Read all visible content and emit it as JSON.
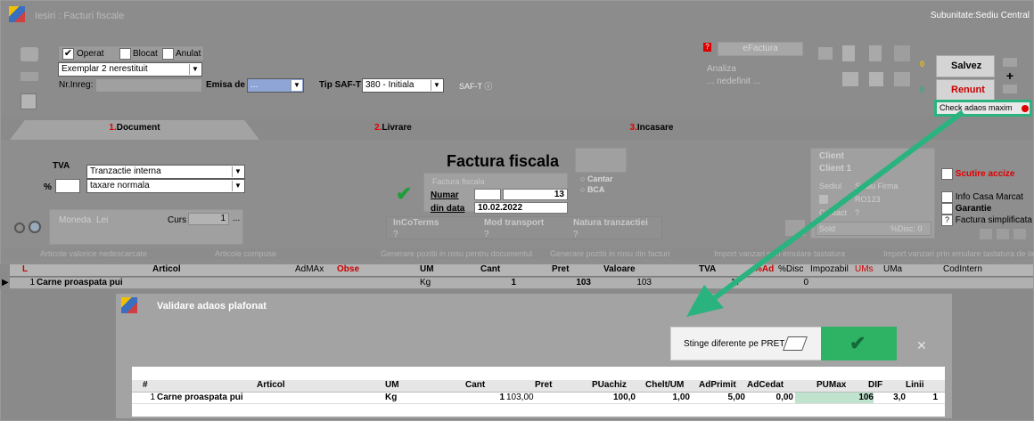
{
  "window": {
    "title": "Iesiri : Facturi fiscale",
    "subunit": "Subunitate:Sediu Central"
  },
  "status": {
    "operat_label": "Operat",
    "blocat_label": "Blocat",
    "anulat_label": "Anulat",
    "operat_checked": true
  },
  "exemplar": {
    "value": "Exemplar 2 nerestituit"
  },
  "nr_inreg": {
    "label": "Nr.Inreg:",
    "value": ""
  },
  "emisa_de": {
    "label": "Emisa de",
    "value": "..."
  },
  "saf_t": {
    "label": "Tip SAF-T",
    "value": "380 - Initiala",
    "button": "SAF-T"
  },
  "efactura": {
    "label": "eFactura",
    "badge": "?"
  },
  "analiza": {
    "label": "Analiza",
    "value": "... nedefinit ..."
  },
  "counters": {
    "a": "0",
    "b": "0"
  },
  "actions": {
    "save": "Salvez",
    "save_hotkey": "z",
    "cancel": "Renunt",
    "cancel_hotkey": "R",
    "plus": "+"
  },
  "check_adaos": {
    "label": "Check adaos maxim"
  },
  "tabs": [
    {
      "num": "1.",
      "label": "Document"
    },
    {
      "num": "2.",
      "label": "Livrare"
    },
    {
      "num": "3.",
      "label": "Incasare"
    }
  ],
  "tva": {
    "label": "TVA",
    "pct": "%",
    "tranzactie": "Tranzactie interna",
    "taxare": "taxare normala"
  },
  "moneda": {
    "label": "Moneda",
    "value": "Lei",
    "curs_label": "Curs",
    "curs_value": "1",
    "curs_btn": "..."
  },
  "factura": {
    "title": "Factura fiscala",
    "sub": "Factura fiscala",
    "numar_label": "Numar",
    "numar": "13",
    "data_label": "din data",
    "data": "10.02.2022"
  },
  "scale": {
    "cantar": "Cantar",
    "bca": "BCA"
  },
  "extra": {
    "incoterms": "InCoTerms",
    "incoterms_val": "?",
    "mod_transport": "Mod transport",
    "mod_transport_val": "?",
    "natura": "Natura tranzactiei",
    "natura_val": "?"
  },
  "client": {
    "label": "Client",
    "name": "Client 1",
    "sediu": "Sediul",
    "firma": "Sediu Firma",
    "cod": "RO123",
    "contact": "Contact",
    "contact_val": "?",
    "sold": "Sold",
    "disc": "%Disc: 0"
  },
  "options": {
    "scutire": "Scutire accize",
    "info_casa": "Info Casa Marcat",
    "garantie": "Garantie",
    "simplificata": "Factura simplificata",
    "simplificata_q": "?"
  },
  "strip": {
    "nedescarcate": "Articole valorice nedescarcate",
    "compuse": "Articole compuse",
    "rosu_document": "Generare pozitii in rosu pentru documentul",
    "rosu_facturi": "Generare pozitii in rosu din facturi",
    "import_emulare": "Import vanzari prin emulare tastatura",
    "import_emulare2": "Import vanzari prin emulare tastatura de la"
  },
  "grid": {
    "columns": [
      "L",
      "Articol",
      "AdMAx",
      "Obse",
      "UM",
      "Cant",
      "Pret",
      "Valoare",
      "TVA",
      "%Ad",
      "%Disc",
      "Impozabil",
      "UMs",
      "UMa",
      "CodIntern"
    ],
    "row": {
      "nr": "1",
      "articol": "Carne proaspata pui",
      "um": "Kg",
      "cant": "1",
      "pret": "103",
      "valoare": "103",
      "tva": "17",
      "disc": "0"
    }
  },
  "dialog": {
    "title": "Validare adaos plafonat",
    "stinge": "Stinge diferente pe PRET",
    "columns": [
      "#",
      "Articol",
      "UM",
      "Cant",
      "Pret",
      "PUachiz",
      "Chelt/UM",
      "AdPrimit",
      "AdCedat",
      "PUMax",
      "DIF",
      "Linii"
    ],
    "row": {
      "nr": "1",
      "articol": "Carne proaspata pui",
      "um": "Kg",
      "cant": "1",
      "pret": "103,00",
      "puachiz": "100,0",
      "chelt": "1,00",
      "adprimit": "5,00",
      "adcedat": "0,00",
      "pumax": "106",
      "dif": "3,0",
      "linii": "1"
    }
  },
  "colors": {
    "highlight": "#2ab37f",
    "ok": "#2eb365",
    "accent_red": "#e00000"
  }
}
